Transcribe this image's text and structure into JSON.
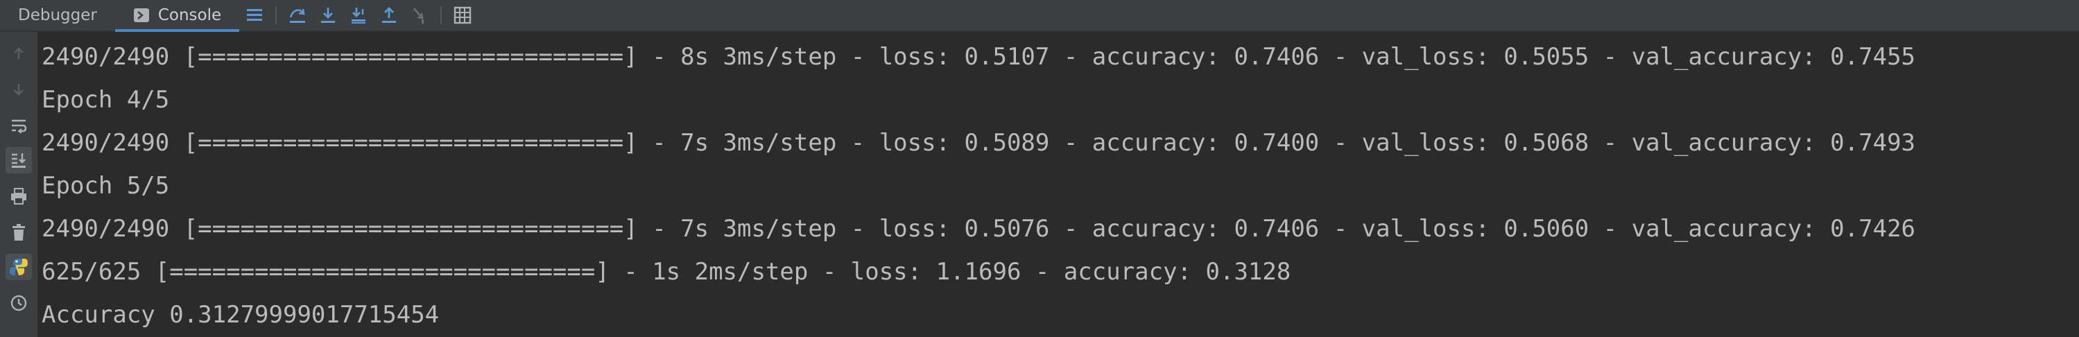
{
  "tabs": [
    {
      "label": "Debugger"
    },
    {
      "label": "Console"
    }
  ],
  "toolbar_icons": [
    "menu-lines-icon",
    "step-over-icon",
    "step-into-icon",
    "force-step-into-icon",
    "step-out-icon",
    "run-to-cursor-icon",
    "evaluate-table-icon"
  ],
  "gutter_icons": [
    "up-arrow-icon",
    "down-arrow-icon",
    "soft-wrap-icon",
    "scroll-to-end-icon",
    "print-icon",
    "trash-icon",
    "python-console-icon",
    "history-icon"
  ],
  "console_lines": [
    "2490/2490 [==============================] - 8s 3ms/step - loss: 0.5107 - accuracy: 0.7406 - val_loss: 0.5055 - val_accuracy: 0.7455",
    "Epoch 4/5",
    "2490/2490 [==============================] - 7s 3ms/step - loss: 0.5089 - accuracy: 0.7400 - val_loss: 0.5068 - val_accuracy: 0.7493",
    "Epoch 5/5",
    "2490/2490 [==============================] - 7s 3ms/step - loss: 0.5076 - accuracy: 0.7406 - val_loss: 0.5060 - val_accuracy: 0.7426",
    "625/625 [==============================] - 1s 2ms/step - loss: 1.1696 - accuracy: 0.3128",
    "Accuracy 0.31279999017715454"
  ],
  "colors": {
    "background": "#2b2b2b",
    "panel": "#3c3f41",
    "text": "#bbbbbb",
    "accent": "#4a88c7"
  }
}
